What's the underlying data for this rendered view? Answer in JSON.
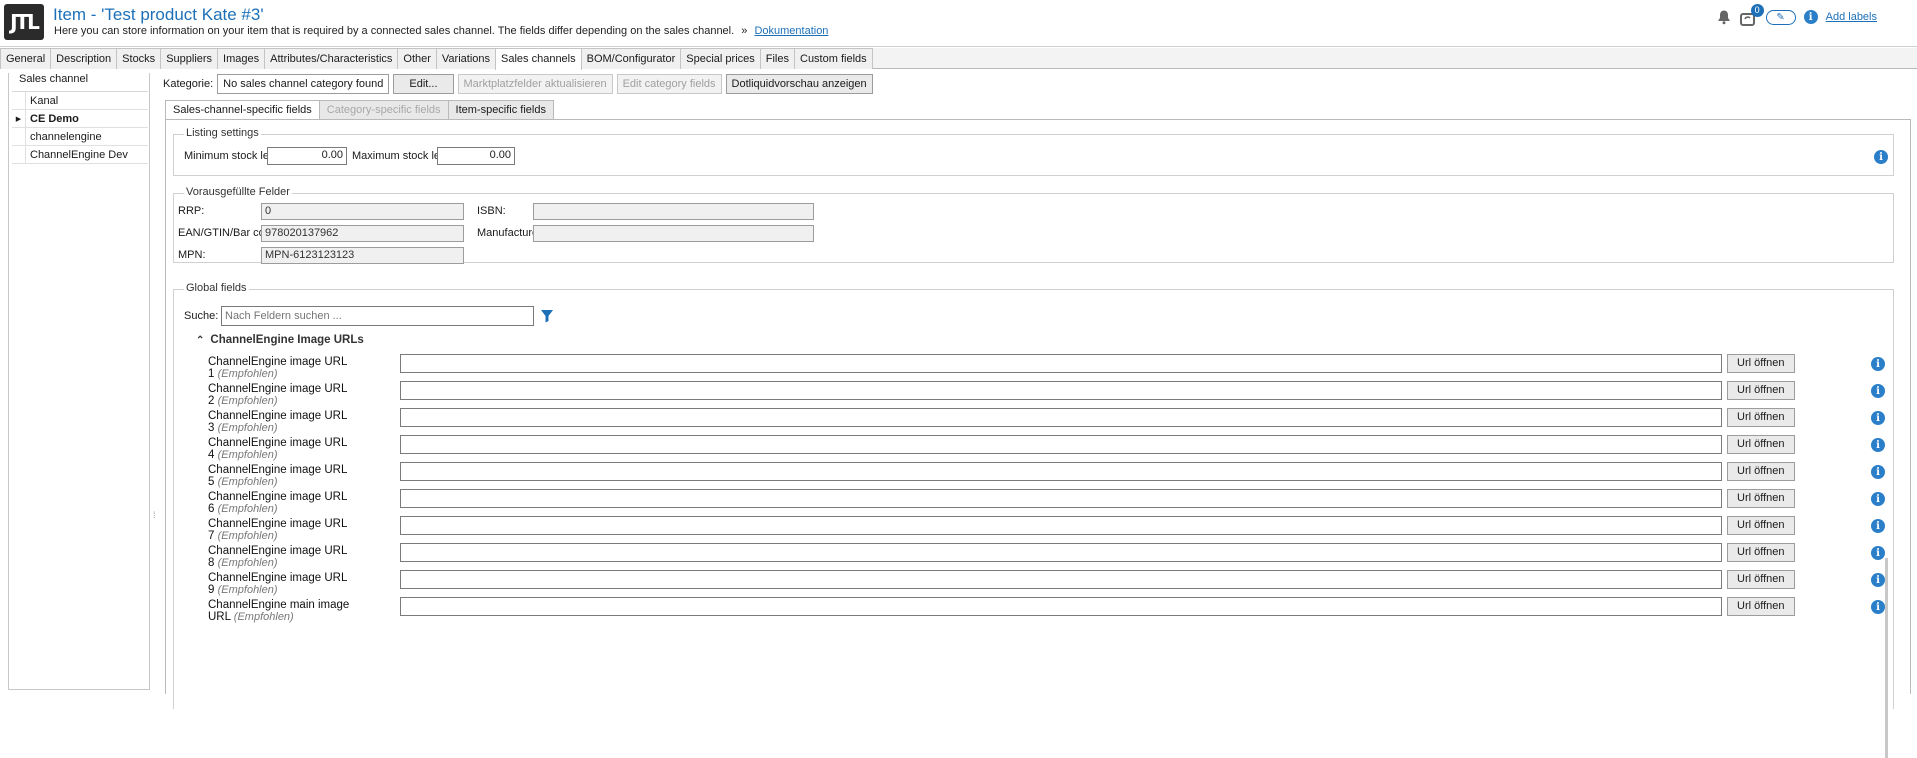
{
  "header": {
    "logo": "JTL",
    "title": "Item - 'Test product Kate #3'",
    "subtitle": "Here you can store information on your item that is required by a connected sales channel. The fields differ depending on the sales channel.",
    "doc_arrow": "»",
    "doc_link": "Dokumentation",
    "notif_count": "0",
    "add_labels": "Add labels"
  },
  "tabs": [
    "General",
    "Description",
    "Stocks",
    "Suppliers",
    "Images",
    "Attributes/Characteristics",
    "Other",
    "Variations",
    "Sales channels",
    "BOM/Configurator",
    "Special prices",
    "Files",
    "Custom fields"
  ],
  "active_tab": "Sales channels",
  "sales_channel": {
    "group_label": "Sales channel",
    "column_header": "Kanal",
    "items": [
      "CE Demo",
      "channelengine",
      "ChannelEngine Dev"
    ],
    "selected": "CE Demo"
  },
  "category": {
    "label": "Kategorie:",
    "value": "No sales channel category found",
    "edit": "Edit...",
    "update_marketplace": "Marktplatzfelder aktualisieren",
    "edit_category_fields": "Edit category fields",
    "preview": "Dotliquidvorschau anzeigen"
  },
  "subtabs": [
    "Sales-channel-specific fields",
    "Category-specific fields",
    "Item-specific fields"
  ],
  "listing": {
    "title": "Listing settings",
    "min_label": "Minimum stock level:",
    "min_value": "0.00",
    "max_label": "Maximum stock level:",
    "max_value": "0.00"
  },
  "prefilled": {
    "title": "Vorausgefüllte Felder",
    "rrp_label": "RRP:",
    "rrp_value": "0",
    "ean_label": "EAN/GTIN/Bar code:",
    "ean_value": "978020137962",
    "mpn_label": "MPN:",
    "mpn_value": "MPN-6123123123",
    "isbn_label": "ISBN:",
    "isbn_value": "",
    "manufacturer_label": "Manufacturer:",
    "manufacturer_value": ""
  },
  "global": {
    "title": "Global fields",
    "search_label": "Suche:",
    "search_placeholder": "Nach Feldern suchen ...",
    "section_title": "ChannelEngine Image URLs",
    "button_label": "Url öffnen",
    "fields": [
      {
        "l1": "ChannelEngine image URL",
        "l2": "1",
        "hint": "(Empfohlen)"
      },
      {
        "l1": "ChannelEngine image URL",
        "l2": "2",
        "hint": "(Empfohlen)"
      },
      {
        "l1": "ChannelEngine image URL",
        "l2": "3",
        "hint": "(Empfohlen)"
      },
      {
        "l1": "ChannelEngine image URL",
        "l2": "4",
        "hint": "(Empfohlen)"
      },
      {
        "l1": "ChannelEngine image URL",
        "l2": "5",
        "hint": "(Empfohlen)"
      },
      {
        "l1": "ChannelEngine image URL",
        "l2": "6",
        "hint": "(Empfohlen)"
      },
      {
        "l1": "ChannelEngine image URL",
        "l2": "7",
        "hint": "(Empfohlen)"
      },
      {
        "l1": "ChannelEngine image URL",
        "l2": "8",
        "hint": "(Empfohlen)"
      },
      {
        "l1": "ChannelEngine image URL",
        "l2": "9",
        "hint": "(Empfohlen)"
      },
      {
        "l1": "ChannelEngine main image",
        "l2": "URL",
        "hint": "(Empfohlen)"
      }
    ]
  },
  "icons": {
    "info": "info-icon",
    "bell": "bell-icon",
    "sync": "sync-icon",
    "pencil": "pencil-icon",
    "filter": "filter-icon",
    "collapse": "chevron-up-icon"
  }
}
